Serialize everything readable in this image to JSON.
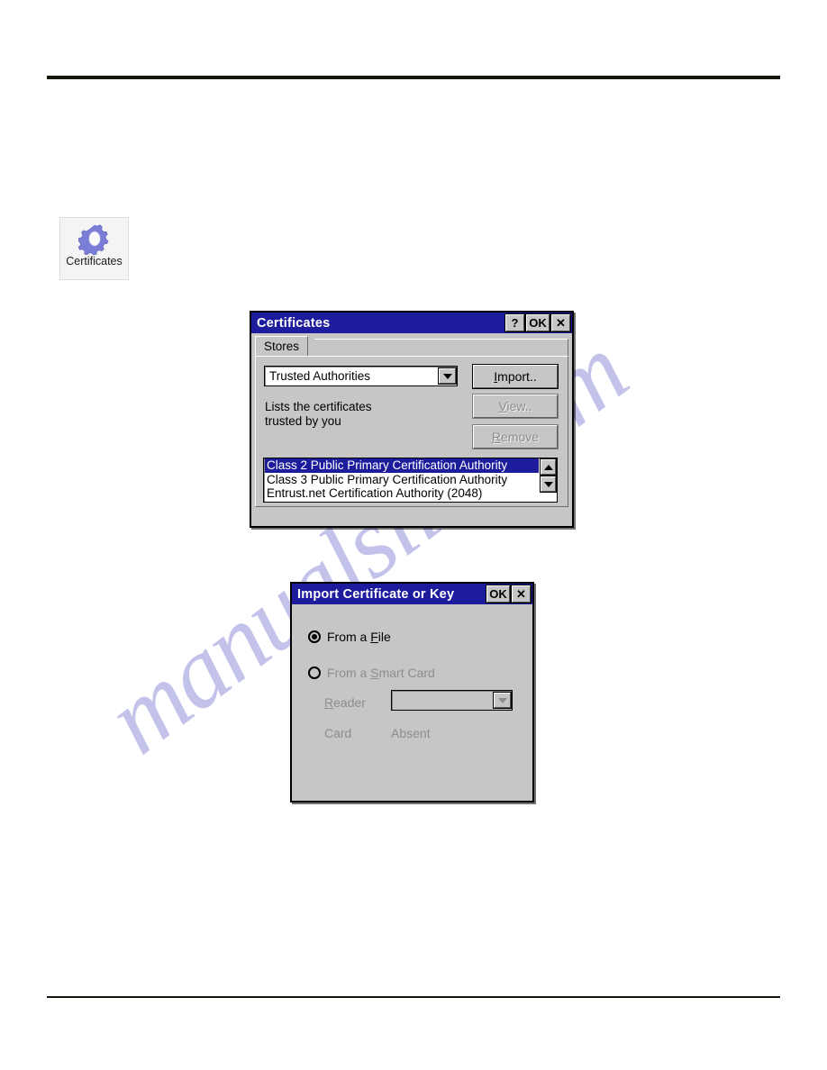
{
  "page": {
    "watermark": "manualslib.com"
  },
  "desktop_icon": {
    "icon": "gear-icon",
    "label": "Certificates"
  },
  "certificates_dialog": {
    "title": "Certificates",
    "titlebar_buttons": [
      {
        "name": "help-button",
        "label": "?"
      },
      {
        "name": "ok-button",
        "label": "OK"
      },
      {
        "name": "close-button",
        "label": "✕"
      }
    ],
    "tabs": [
      {
        "label": "Stores",
        "active": true
      }
    ],
    "store_combo": {
      "value": "Trusted Authorities",
      "arrow": "chevron-down-icon"
    },
    "description": "Lists the certificates\ntrusted by you",
    "buttons": [
      {
        "name": "import-button",
        "label": "Import..",
        "accel": "I",
        "enabled": true
      },
      {
        "name": "view-button",
        "label": "View..",
        "accel": "V",
        "enabled": false
      },
      {
        "name": "remove-button",
        "label": "Remove",
        "accel": "R",
        "enabled": false
      }
    ],
    "certificate_list": [
      {
        "text": "Class 2 Public Primary Certification Authority",
        "selected": true
      },
      {
        "text": "Class 3 Public Primary Certification Authority",
        "selected": false
      },
      {
        "text": "Entrust.net Certification Authority (2048)",
        "selected": false
      }
    ],
    "scrollbar": {
      "up": "scroll-up-icon",
      "down": "scroll-down-icon"
    }
  },
  "import_dialog": {
    "title": "Import Certificate or Key",
    "titlebar_buttons": [
      {
        "name": "ok-button",
        "label": "OK"
      },
      {
        "name": "close-button",
        "label": "✕"
      }
    ],
    "options": [
      {
        "label_pre": "From a ",
        "accel": "F",
        "label_post": "ile",
        "selected": true,
        "enabled": true
      },
      {
        "label_pre": "From a ",
        "accel": "S",
        "label_post": "mart Card",
        "selected": false,
        "enabled": false
      }
    ],
    "reader": {
      "label_pre": "",
      "accel": "R",
      "label_post": "eader",
      "value": "",
      "enabled": false
    },
    "card": {
      "label": "Card",
      "value": "Absent"
    }
  },
  "colors": {
    "titlebar": "#1c1c9c",
    "dialog_face": "#c6c6c6",
    "selection": "#1c1c9c",
    "rule": "#12180a",
    "watermark": "#c3c2ea",
    "gear": "#7b7ed6"
  }
}
